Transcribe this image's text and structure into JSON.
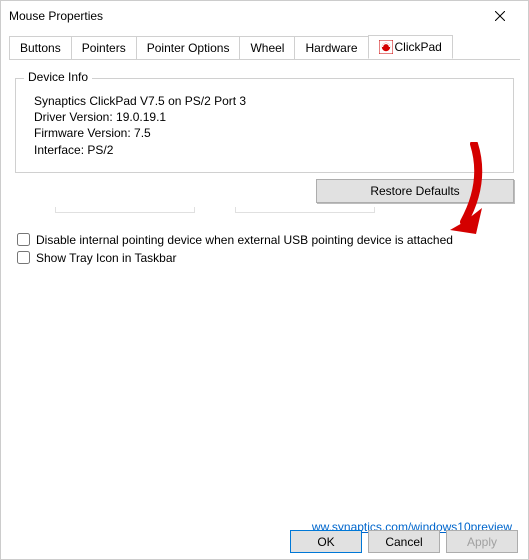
{
  "window": {
    "title": "Mouse Properties"
  },
  "tabs": {
    "buttons": "Buttons",
    "pointers": "Pointers",
    "pointer_options": "Pointer Options",
    "wheel": "Wheel",
    "hardware": "Hardware",
    "clickpad": "ClickPad"
  },
  "device_info": {
    "legend": "Device Info",
    "line1": "Synaptics ClickPad V7.5 on PS/2 Port 3",
    "line2": "Driver Version: 19.0.19.1",
    "line3": "Firmware Version: 7.5",
    "line4": "Interface: PS/2"
  },
  "buttons": {
    "restore_defaults": "Restore Defaults",
    "ok": "OK",
    "cancel": "Cancel",
    "apply": "Apply"
  },
  "checkboxes": {
    "disable_internal": "Disable internal pointing device when external USB pointing device is attached",
    "tray_icon": "Show Tray Icon in Taskbar"
  },
  "link": {
    "text": "ww.synaptics.com/windows10preview"
  }
}
